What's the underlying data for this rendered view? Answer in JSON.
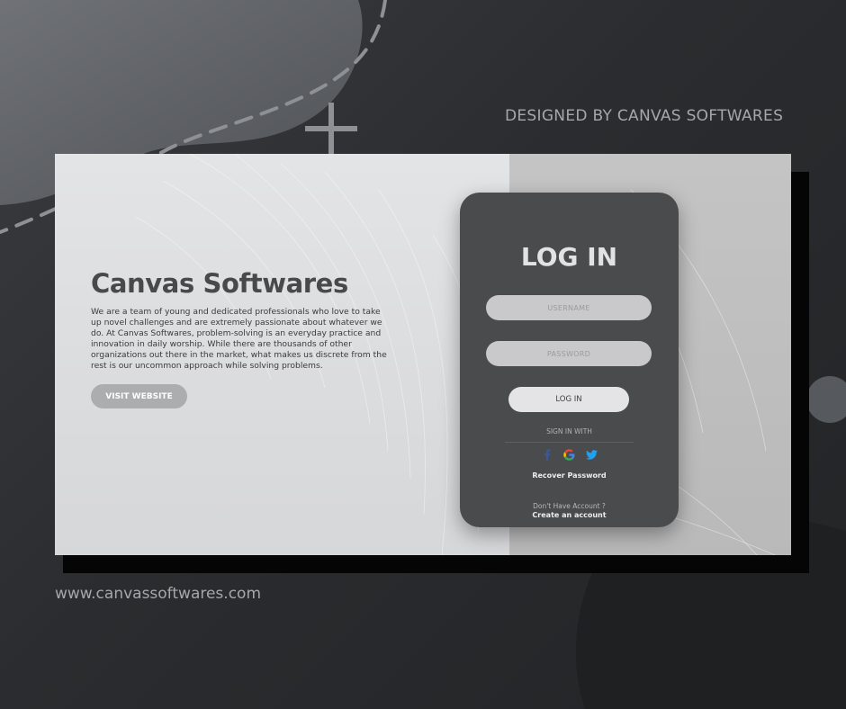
{
  "header": {
    "designed_by": "DESIGNED BY CANVAS SOFTWARES"
  },
  "footer": {
    "website_url": "www.canvassoftwares.com"
  },
  "hero": {
    "title": "Canvas Softwares",
    "description": "We are a team of young and dedicated professionals who love to take up novel challenges and are extremely passionate about whatever we do. At Canvas Softwares, problem-solving is an everyday practice and innovation in daily worship. While there are thousands of other organizations out there in the market, what makes us discrete from the rest is our uncommon approach while solving problems.",
    "visit_button": "VISIT WEBSITE"
  },
  "login": {
    "title": "LOG IN",
    "username_placeholder": "USERNAME",
    "password_placeholder": "PASSWORD",
    "login_button": "LOG IN",
    "sign_in_with": "SIGN IN WITH",
    "social": [
      {
        "icon": "facebook-icon",
        "color": "#3b5998"
      },
      {
        "icon": "google-icon",
        "color": "#4285f4"
      },
      {
        "icon": "twitter-icon",
        "color": "#1da1f2"
      }
    ],
    "recover_password": "Recover Password",
    "no_account": "Don't Have Account ?",
    "create_account": "Create an account"
  },
  "colors": {
    "background": "#2b2d30",
    "card_left": "#dcdddf",
    "card_right": "#bebebf",
    "panel": "#4a4b4d",
    "text_muted": "#a6a7aa"
  }
}
